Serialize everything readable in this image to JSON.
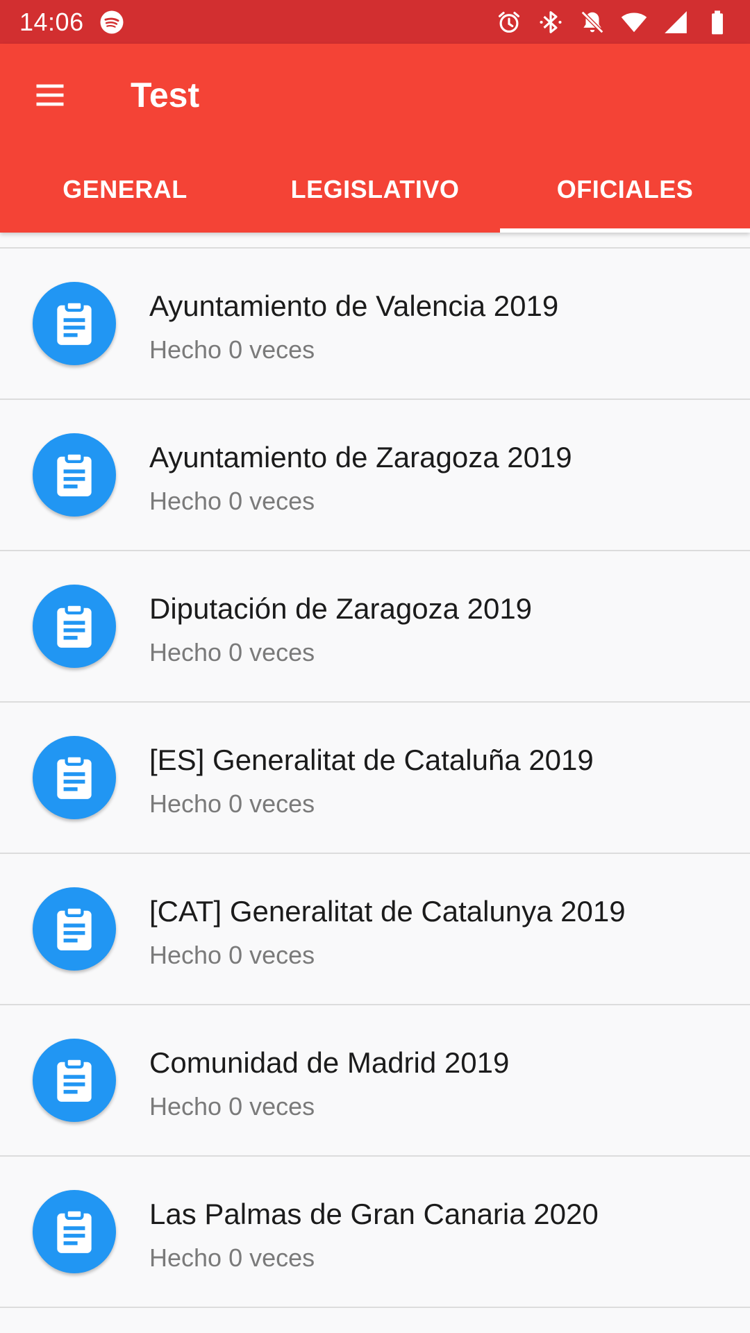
{
  "status_bar": {
    "time": "14:06",
    "icons": [
      "spotify-icon",
      "alarm-icon",
      "bluetooth-icon",
      "notifications-off-icon",
      "wifi-icon",
      "signal-icon",
      "battery-icon"
    ]
  },
  "app_bar": {
    "title": "Test",
    "menu_icon": "hamburger-menu-icon",
    "background_color": "#f44336",
    "status_color": "#d22f30"
  },
  "tabs": [
    {
      "label": "GENERAL",
      "selected": false
    },
    {
      "label": "LEGISLATIVO",
      "selected": false
    },
    {
      "label": "OFICIALES",
      "selected": true
    }
  ],
  "items": [
    {
      "title": "Ayuntamiento de Valencia 2019",
      "subtitle": "Hecho 0 veces"
    },
    {
      "title": "Ayuntamiento de Zaragoza 2019",
      "subtitle": "Hecho 0 veces"
    },
    {
      "title": "Diputación de Zaragoza 2019",
      "subtitle": "Hecho 0 veces"
    },
    {
      "title": "[ES] Generalitat de Cataluña 2019",
      "subtitle": "Hecho 0 veces"
    },
    {
      "title": "[CAT] Generalitat de Catalunya 2019",
      "subtitle": "Hecho 0 veces"
    },
    {
      "title": "Comunidad de Madrid 2019",
      "subtitle": "Hecho 0 veces"
    },
    {
      "title": "Las Palmas de Gran Canaria 2020",
      "subtitle": "Hecho 0 veces"
    }
  ],
  "item_icon": "clipboard-icon",
  "accent_color": "#2196f3"
}
